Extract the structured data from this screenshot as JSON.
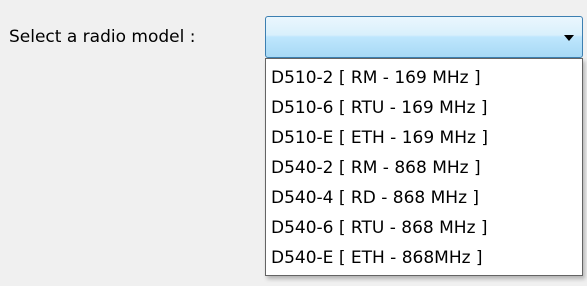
{
  "form": {
    "label": "Select a radio model :",
    "selected_value": ""
  },
  "dropdown": {
    "options": [
      {
        "label": "D510-2 [ RM - 169 MHz ]"
      },
      {
        "label": "D510-6 [ RTU - 169 MHz ]"
      },
      {
        "label": "D510-E [ ETH - 169 MHz ]"
      },
      {
        "label": "D540-2 [ RM - 868 MHz ]"
      },
      {
        "label": "D540-4 [ RD - 868 MHz ]"
      },
      {
        "label": "D540-6 [ RTU - 868 MHz ]"
      },
      {
        "label": "D540-E [ ETH - 868MHz ]"
      }
    ]
  },
  "icons": {
    "combo_arrow": "chevron-down-icon"
  },
  "colors": {
    "background": "#f0f0f0",
    "combo_border": "#3c7fb1",
    "combo_fill": "#bee6fd",
    "list_background": "#ffffff",
    "list_border": "#646464"
  }
}
